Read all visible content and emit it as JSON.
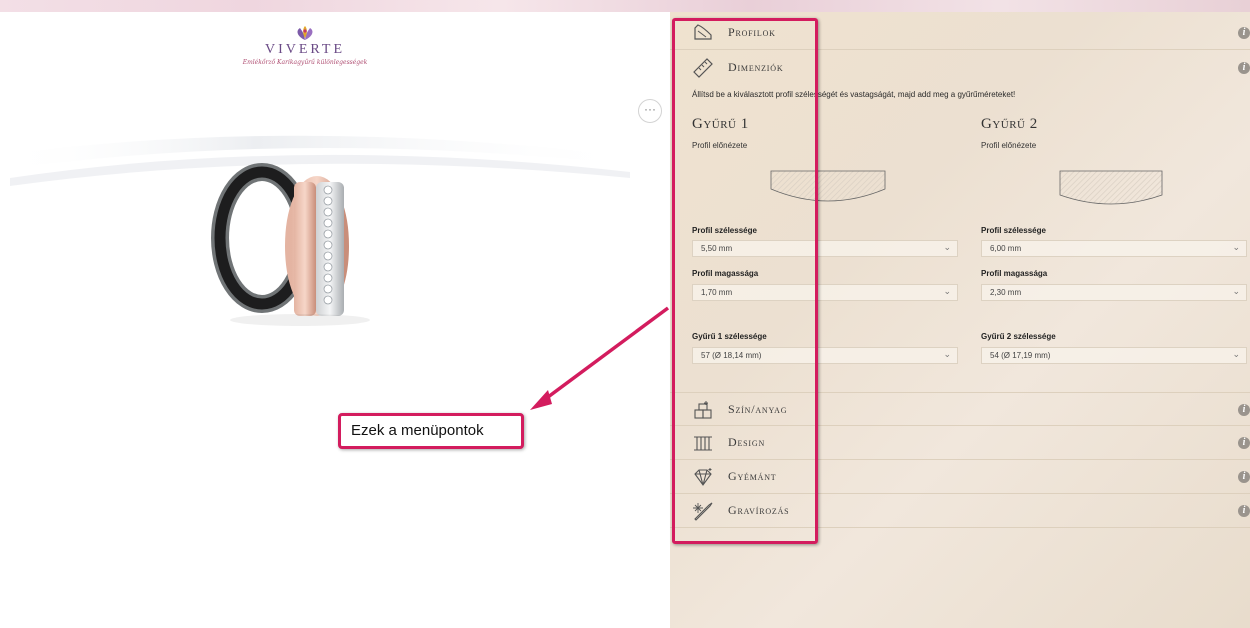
{
  "logo": {
    "brand": "VIVERTE",
    "tagline": "Emlékőrző Karikagyűrű különlegességek"
  },
  "more_button": "···",
  "callout": {
    "text": "Ezek a menüpontok"
  },
  "panel": {
    "menu": [
      {
        "label": "Profilok",
        "icon": "ring-profile-icon"
      },
      {
        "label": "Dimenziók",
        "icon": "ruler-icon"
      },
      {
        "label": "Szín/anyag",
        "icon": "layers-icon"
      },
      {
        "label": "Design",
        "icon": "columns-icon"
      },
      {
        "label": "Gyémánt",
        "icon": "diamond-icon"
      },
      {
        "label": "Gravírozás",
        "icon": "engraving-pen-icon"
      }
    ],
    "info_glyph": "i",
    "intro": "Állítsd be a kiválasztott profil szélességét és vastagságát, majd add meg a gyűrűméreteket!",
    "rings": [
      {
        "title": "Gyűrű 1",
        "preview_label": "Profil előnézete",
        "width_label": "Profil szélessége",
        "width_value": "5,50 mm",
        "height_label": "Profil magassága",
        "height_value": "1,70 mm",
        "size_label": "Gyűrű 1 szélessége",
        "size_value": "57 (Ø 18,14 mm)"
      },
      {
        "title": "Gyűrű 2",
        "preview_label": "Profil előnézete",
        "width_label": "Profil szélessége",
        "width_value": "6,00 mm",
        "height_label": "Profil magassága",
        "height_value": "2,30 mm",
        "size_label": "Gyűrű 2 szélessége",
        "size_value": "54 (Ø 17,19 mm)"
      }
    ]
  },
  "colors": {
    "highlight": "#d31c5e",
    "panel_bg": "#ece0d1",
    "brand": "#6a4a86"
  }
}
